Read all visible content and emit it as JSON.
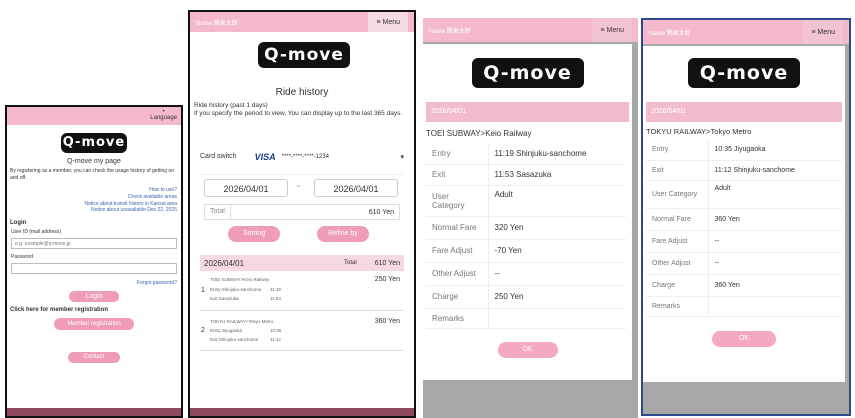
{
  "p1": {
    "language": "Language",
    "title": "Q-move my page",
    "intro": "By registering as a member, you can check the usage history of getting on and off.",
    "links": [
      "How to use?",
      "Check available areas",
      "Notice about transit history in Kansai area",
      "Notice about unavailable Dec 22, 2025"
    ],
    "login_heading": "Login",
    "userid_label": "User ID (mail address)",
    "userid_placeholder": "e.g. example@q-move.jp",
    "password_label": "Password",
    "forgot": "Forgot password?",
    "login_btn": "Login",
    "register_heading": "Click here for member registration",
    "register_btn": "Member registration",
    "contact_btn": "Contact"
  },
  "logo": "Q-move",
  "p2": {
    "name": "Name 関東太郎",
    "menu": "≡ Menu",
    "title": "Ride history",
    "desc": "Ride history (past 1 days)\nIf you specify the period to view, You can display up to the last 365 days.",
    "card_switch": "Card switch",
    "card_brand": "VISA",
    "card_num": "****-****-****-1234",
    "date_from": "2026/04/01",
    "date_sep": "~",
    "date_to": "2026/04/01",
    "total_label": "Total",
    "total_value": "610 Yen",
    "sort_btn": "Sorting",
    "refine_btn": "Refine by",
    "list_date": "2026/04/01",
    "list_total_label": "Total",
    "list_total": "610 Yen",
    "rides": [
      {
        "no": "1",
        "route": "TOEI SUBWAY>Keio Railway",
        "entry": "Entry:Shinjuku-sanchome",
        "entry_time": "11:19",
        "exit": "Exit:Sasazuka",
        "exit_time": "11:53",
        "fare": "250 Yen"
      },
      {
        "no": "2",
        "route": "TOKYU RAILWAY>Tokyo Metro",
        "entry": "Entry:Jiyugaoka",
        "entry_time": "10:35",
        "exit": "Exit:Shinjuku-sanchome",
        "exit_time": "11:12",
        "fare": "360 Yen"
      }
    ]
  },
  "p3": {
    "name": "Name 関東太郎",
    "menu": "≡ Menu",
    "date": "2026/04/01",
    "route": "TOEI SUBWAY>Keio Railway",
    "rows": [
      {
        "k": "Entry",
        "v": "11:19 Shinjuku-sanchome"
      },
      {
        "k": "Exit",
        "v": "11:53 Sasazuka"
      },
      {
        "k": "User Category",
        "v": "Adult"
      },
      {
        "k": "Normal Fare",
        "v": "320 Yen"
      },
      {
        "k": "Fare Adjust",
        "v": "-70 Yen"
      },
      {
        "k": "Other Adjust",
        "v": "--"
      },
      {
        "k": "Charge",
        "v": "250 Yen"
      },
      {
        "k": "Remarks",
        "v": ""
      }
    ],
    "ok": "OK"
  },
  "p4": {
    "name": "Name 関東太郎",
    "menu": "≡ Menu",
    "date": "2026/04/01",
    "route": "TOKYU RAILWAY>Tokyo Metro",
    "rows": [
      {
        "k": "Entry",
        "v": "10:35 Jiyugaoka"
      },
      {
        "k": "Exit",
        "v": "11:12 Shinjuku-sanchome"
      },
      {
        "k": "User Category",
        "v": "Adult"
      },
      {
        "k": "Normal Fare",
        "v": "360 Yen"
      },
      {
        "k": "Fare Adjust",
        "v": "--"
      },
      {
        "k": "Other Adjust",
        "v": "--"
      },
      {
        "k": "Charge",
        "v": "360 Yen"
      },
      {
        "k": "Remarks",
        "v": ""
      }
    ],
    "ok": "OK"
  }
}
